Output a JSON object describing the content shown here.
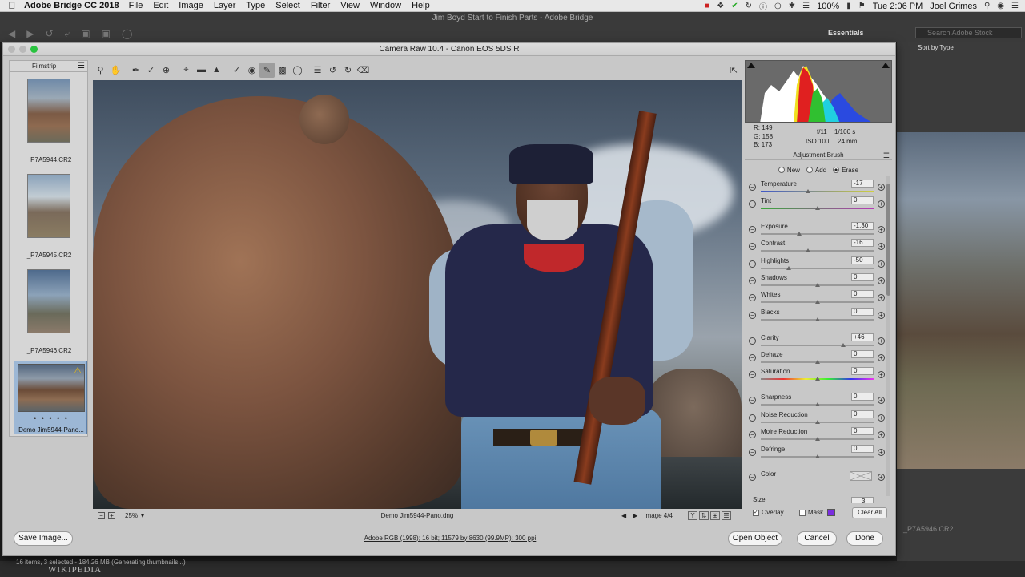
{
  "menubar": {
    "app_name": "Adobe Bridge CC 2018",
    "items": [
      "File",
      "Edit",
      "Image",
      "Layer",
      "Type",
      "Select",
      "Filter",
      "View",
      "Window",
      "Help"
    ],
    "battery": "100%",
    "clock": "Tue 2:06 PM",
    "user": "Joel Grimes"
  },
  "bridge": {
    "window_title": "Jim Boyd Start to Finish Parts - Adobe Bridge",
    "workspace": "Essentials",
    "stock_search_placeholder": "Search Adobe Stock",
    "sort_label": "Sort by Type",
    "right_caption": "_P7A5946.CR2",
    "status": "16 items, 3 selected - 184.26 MB (Generating thumbnails...)",
    "wiki_text": "WIKIPEDIA"
  },
  "dialog": {
    "title": "Camera Raw 10.4  -  Canon EOS 5DS R",
    "filmstrip": {
      "header": "Filmstrip",
      "items": [
        {
          "name": "_P7A5944.CR2"
        },
        {
          "name": "_P7A5945.CR2"
        },
        {
          "name": "_P7A5946.CR2"
        },
        {
          "name": "Demo Jim5944-Pano..."
        }
      ],
      "selected_dots": "• • • • •"
    },
    "preview": {
      "zoom": "25%",
      "filename": "Demo Jim5944-Pano.dng",
      "image_count": "Image 4/4"
    },
    "histogram": {
      "r": "R:  149",
      "g": "G:  158",
      "b": "B:  173",
      "aperture": "f/11",
      "shutter": "1/100 s",
      "iso": "ISO 100",
      "focal": "24 mm"
    },
    "panel": {
      "title": "Adjustment Brush",
      "modes": [
        "New",
        "Add",
        "Erase"
      ],
      "selected_mode": "Erase",
      "sliders": [
        {
          "label": "Temperature",
          "value": "-17",
          "pos": 0.42
        },
        {
          "label": "Tint",
          "value": "0",
          "pos": 0.5
        },
        {
          "label": "Exposure",
          "value": "-1.30",
          "pos": 0.34
        },
        {
          "label": "Contrast",
          "value": "-16",
          "pos": 0.42
        },
        {
          "label": "Highlights",
          "value": "-50",
          "pos": 0.25
        },
        {
          "label": "Shadows",
          "value": "0",
          "pos": 0.5
        },
        {
          "label": "Whites",
          "value": "0",
          "pos": 0.5
        },
        {
          "label": "Blacks",
          "value": "0",
          "pos": 0.5
        },
        {
          "label": "Clarity",
          "value": "+46",
          "pos": 0.73
        },
        {
          "label": "Dehaze",
          "value": "0",
          "pos": 0.5
        },
        {
          "label": "Saturation",
          "value": "0",
          "pos": 0.5
        },
        {
          "label": "Sharpness",
          "value": "0",
          "pos": 0.5
        },
        {
          "label": "Noise Reduction",
          "value": "0",
          "pos": 0.5
        },
        {
          "label": "Moire Reduction",
          "value": "0",
          "pos": 0.5
        },
        {
          "label": "Defringe",
          "value": "0",
          "pos": 0.5
        }
      ],
      "color_label": "Color",
      "size_label": "Size",
      "size_value": "3",
      "overlay_label": "Overlay",
      "mask_label": "Mask",
      "clear_all": "Clear All",
      "mask_color": "#7a2de0"
    },
    "footer": {
      "save_image": "Save Image...",
      "workflow": "Adobe RGB (1998); 16 bit; 11579 by 8630 (99.9MP); 300 ppi",
      "open_object": "Open Object",
      "cancel": "Cancel",
      "done": "Done"
    }
  }
}
